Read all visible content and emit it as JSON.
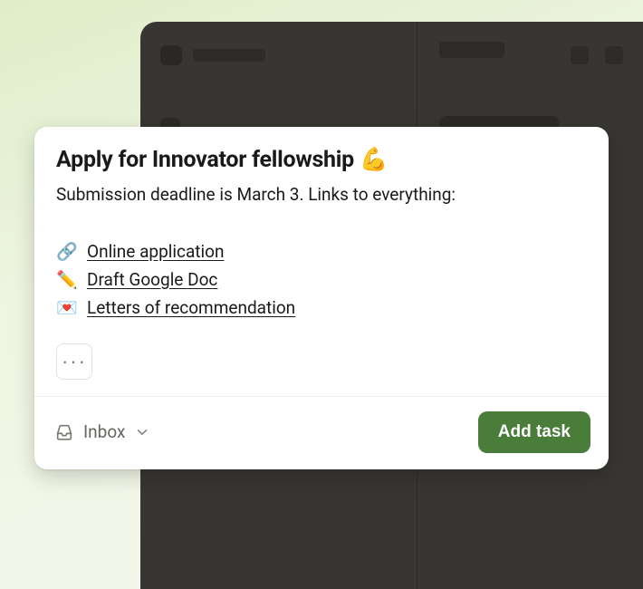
{
  "quick_add": {
    "title": "Apply for Innovator fellowship 💪",
    "description": "Submission deadline is March 3. Links to everything:",
    "links": [
      {
        "emoji": "🔗",
        "label": "Online application"
      },
      {
        "emoji": "✏️",
        "label": "Draft Google Doc"
      },
      {
        "emoji": "💌",
        "label": "Letters of recommendation"
      }
    ],
    "more_label": "···",
    "destination": {
      "label": "Inbox"
    },
    "submit_label": "Add task"
  }
}
